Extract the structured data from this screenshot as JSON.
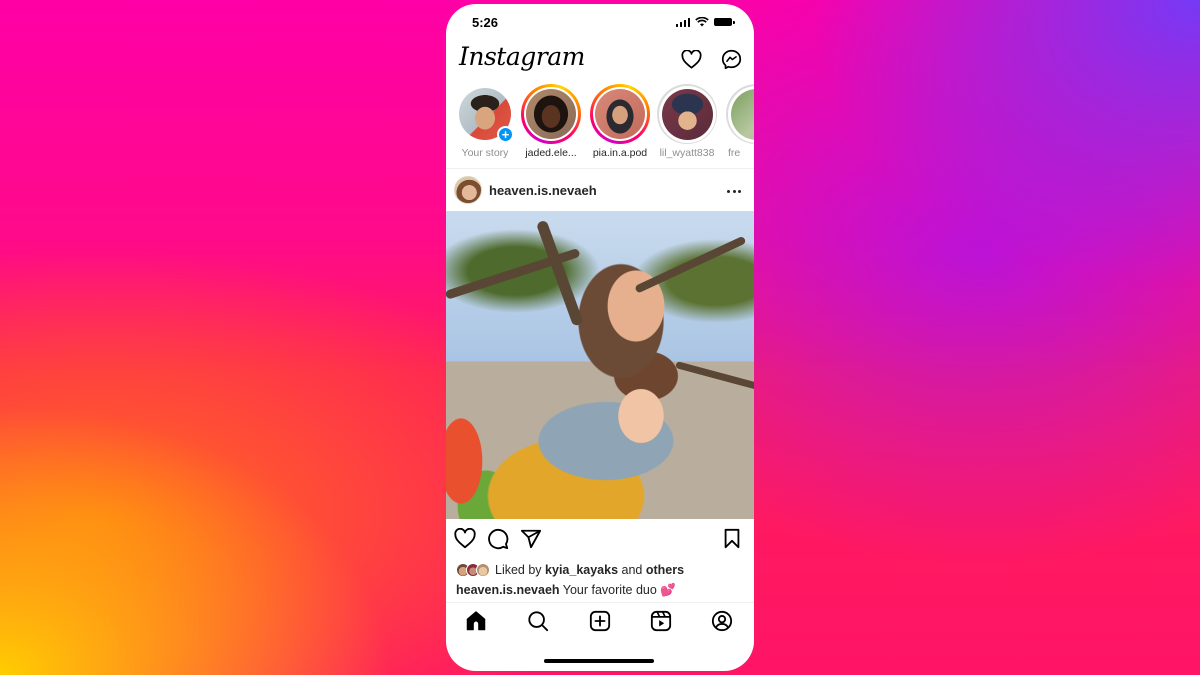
{
  "status_bar": {
    "time": "5:26",
    "icons": [
      "signal-icon",
      "wifi-icon",
      "battery-icon"
    ]
  },
  "header": {
    "logo": "Instagram",
    "icons": [
      "heart-icon",
      "messenger-icon"
    ]
  },
  "stories": [
    {
      "username": "Your story",
      "ring": "none",
      "own": true,
      "add_badge": "+"
    },
    {
      "username": "jaded.ele...",
      "ring": "unseen"
    },
    {
      "username": "pia.in.a.pod",
      "ring": "unseen"
    },
    {
      "username": "lil_wyatt838",
      "ring": "seen"
    },
    {
      "username": "fre",
      "ring": "seen"
    }
  ],
  "post": {
    "username": "heaven.is.nevaeh",
    "more_icon": "more-horizontal-icon",
    "actions": [
      "heart-icon",
      "comment-icon",
      "share-icon",
      "bookmark-icon"
    ],
    "likes": {
      "prefix": "Liked by",
      "user": "kyia_kayaks",
      "connector": "and",
      "others": "others"
    },
    "caption": {
      "username": "heaven.is.nevaeh",
      "text": "Your favorite duo 💕"
    }
  },
  "bottom_nav": [
    {
      "name": "home",
      "icon": "home-icon",
      "active": true
    },
    {
      "name": "search",
      "icon": "search-icon",
      "active": false
    },
    {
      "name": "create",
      "icon": "plus-square-icon",
      "active": false
    },
    {
      "name": "reels",
      "icon": "reels-icon",
      "active": false
    },
    {
      "name": "profile",
      "icon": "profile-icon",
      "active": false
    }
  ],
  "colors": {
    "accent_blue": "#0095f6",
    "text_primary": "#262626",
    "text_muted": "#8e8e8e",
    "divider": "#efefef"
  }
}
